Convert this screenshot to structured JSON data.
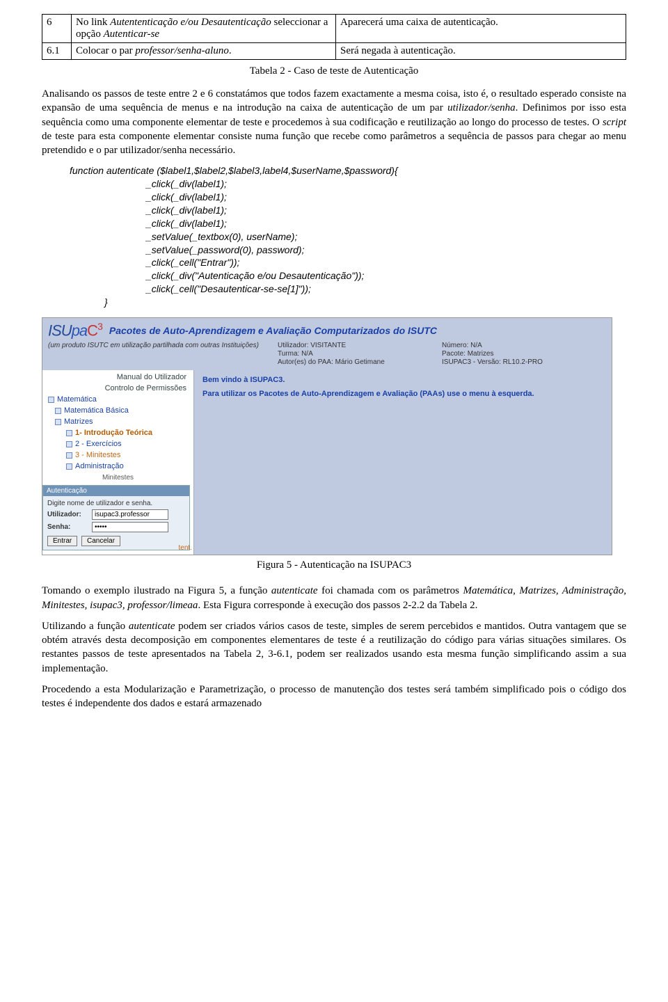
{
  "table": {
    "r1": {
      "num": "6",
      "descA": "No link ",
      "descIt": "Autententicação e/ou Desautenticação",
      "descB": " seleccionar a opção ",
      "descIt2": "Autenticar-se",
      "result": "Aparecerá uma caixa de autenticação."
    },
    "r2": {
      "num": "6.1",
      "descA": "Colocar o par ",
      "descIt": "professor/senha-aluno",
      "descB": ".",
      "result": "Será negada à autenticação."
    }
  },
  "caption1": "Tabela 2 - Caso de teste de Autenticação",
  "p1a": "Analisando os passos de teste entre 2 e 6 constatámos que todos fazem exactamente a mesma coisa, isto é, o resultado esperado consiste na expansão de uma sequência de menus e na introdução na caixa de autenticação de um par ",
  "p1it": "utilizador/senha",
  "p1b": ". Definimos por isso esta sequência como uma componente elementar de teste e procedemos à sua codificação e reutilização ao longo do processo de testes. O ",
  "p1it2": "script",
  "p1c": " de teste para esta componente elementar consiste numa função que recebe como parâmetros a sequência de passos para chegar ao menu pretendido e o par utilizador/senha necessário.",
  "code": {
    "l1": "function autenticate ($label1,$label2,$label3,label4,$userName,$password){",
    "l2": "_click(_div(label1);",
    "l3": "_click(_div(label1);",
    "l4": "_click(_div(label1);",
    "l5": "_click(_div(label1);",
    "l6": "_setValue(_textbox(0), userName);",
    "l7": "_setValue(_password(0), password);",
    "l8": "_click(_cell(\"Entrar\"));",
    "l9": "_click(_div(\"Autenticação e/ou Desautenticação\"));",
    "l10": "_click(_cell(\"Desautenticar-se-se[1]\"));",
    "l11": "}"
  },
  "ss": {
    "logoA": "ISU",
    "logoB": "pa",
    "logoC": "C",
    "logoD": "3",
    "title": "Pacotes de Auto-Aprendizagem e Avaliação Computarizados do ISUTC",
    "subLeft": "(um produto ISUTC em utilização partilhada com outras Instituições)",
    "info": {
      "utilizador": "Utilizador: VISITANTE",
      "numero": "Número: N/A",
      "turma": "Turma: N/A",
      "pacote": "Pacote: Matrizes",
      "autor": "Autor(es) do PAA: Mário Getimane",
      "versao": "ISUPAC3 - Versão: RL10.2-PRO"
    },
    "side": {
      "manual": "Manual do Utilizador",
      "controlo": "Controlo de Permissões",
      "mat": "Matemática",
      "matb": "Matemática Básica",
      "matr": "Matrizes",
      "i1": "1- Introdução Teórica",
      "i2": "2 - Exercícios",
      "i3": "3 - Minitestes",
      "admin": "Administração",
      "mini": "Minitestes",
      "tent": "tent."
    },
    "auth": {
      "head": "Autenticação",
      "msg": "Digite nome de utilizador e senha.",
      "labU": "Utilizador:",
      "valU": "isupac3.professor",
      "labS": "Senha:",
      "valS": "•••••",
      "btnE": "Entrar",
      "btnC": "Cancelar"
    },
    "cont": {
      "wel": "Bem vindo à ISUPAC3.",
      "msg": "Para utilizar os Pacotes de Auto-Aprendizagem e Avaliação (PAAs) use o menu à esquerda."
    }
  },
  "caption2": "Figura 5 - Autenticação na ISUPAC3",
  "p2a": "Tomando o exemplo ilustrado na Figura 5, a função ",
  "p2it1": "autenticate",
  "p2b": " foi chamada com os parâmetros ",
  "p2it2": "Matemática, Matrizes, Administração, Minitestes, isupac3, professor/limeaa",
  "p2c": ". Esta Figura corresponde à execução dos passos 2-2.2 da Tabela 2.",
  "p3a": "Utilizando a função ",
  "p3it": "autenticate",
  "p3b": " podem ser criados vários casos de teste, simples de serem percebidos e mantidos. Outra vantagem que se obtém através desta decomposição em componentes elementares de teste é a reutilização do código para várias situações similares. Os restantes passos de teste apresentados na Tabela 2, 3-6.1, podem ser realizados usando esta mesma função simplificando assim a sua implementação.",
  "p4": "Procedendo a esta Modularização e Parametrização, o processo de manutenção dos testes será também simplificado pois o código dos testes é independente dos dados e estará armazenado"
}
